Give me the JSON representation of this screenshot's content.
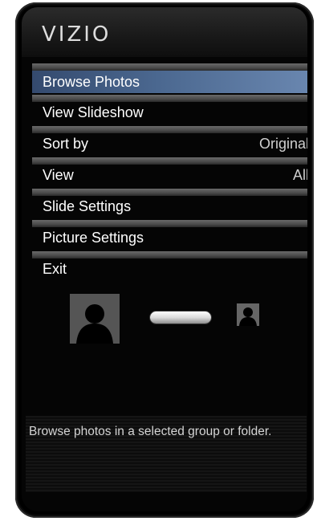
{
  "brand": {
    "logo": "VIZIO"
  },
  "menu": {
    "items": [
      {
        "label": "Browse Photos",
        "value": "",
        "selected": true
      },
      {
        "label": "View Slideshow",
        "value": ""
      },
      {
        "label": "Sort by",
        "value": "Original"
      },
      {
        "label": "View",
        "value": "All"
      },
      {
        "label": "Slide Settings",
        "value": ""
      },
      {
        "label": "Picture Settings",
        "value": ""
      },
      {
        "label": "Exit",
        "value": ""
      }
    ]
  },
  "preview": {
    "large_thumb_icon": "person-icon",
    "small_thumb_icon": "person-icon"
  },
  "help": {
    "text": "Browse photos in a selected group or folder."
  },
  "colors": {
    "highlight": "#4b6890",
    "background": "#000000"
  }
}
